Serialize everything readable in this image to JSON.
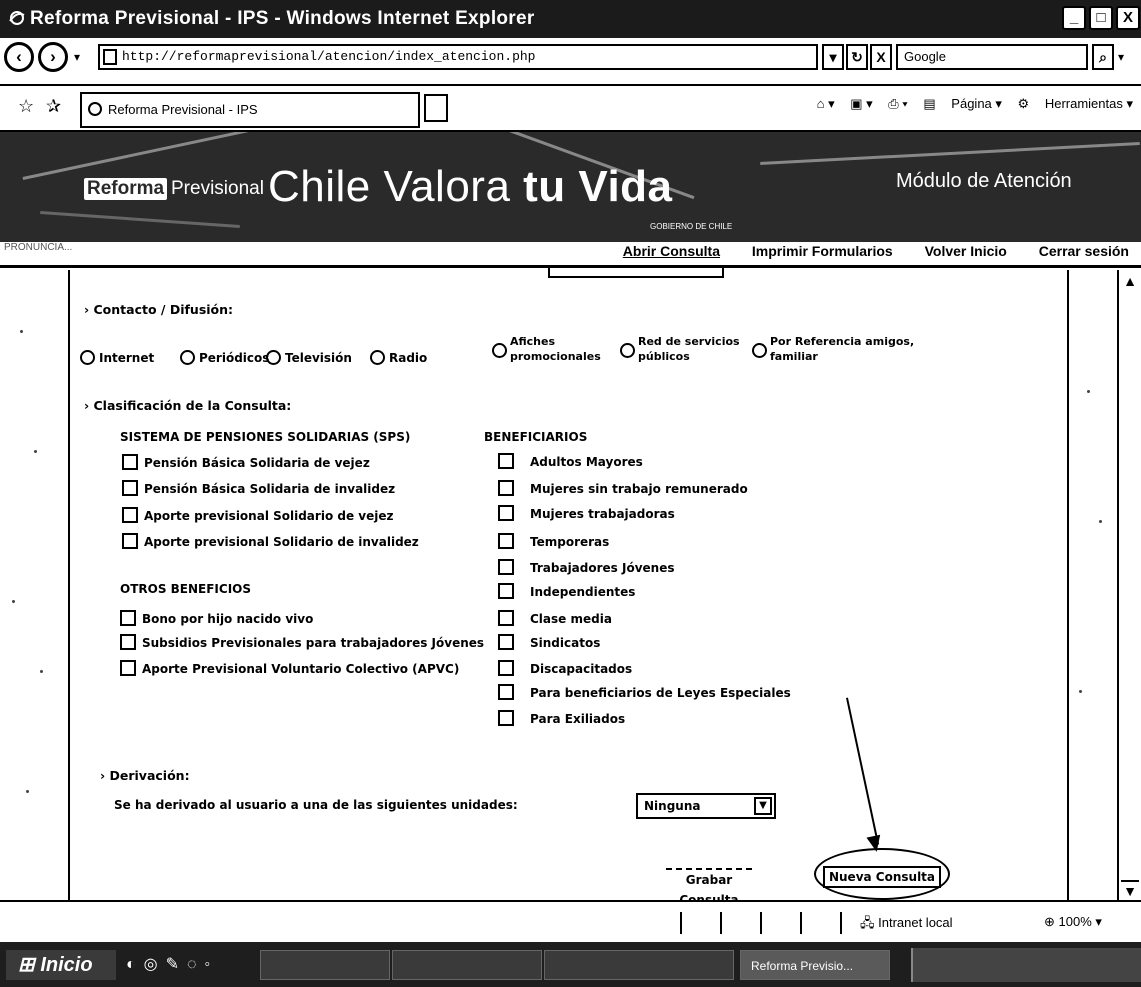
{
  "window": {
    "title": "Reforma Previsional - IPS - Windows Internet Explorer",
    "minimize_glyph": "_",
    "maximize_glyph": "□",
    "close_glyph": "X"
  },
  "address_bar": {
    "url": "http://reformaprevisional/atencion/index_atencion.php",
    "search_value": "Google",
    "refresh_glyph": "↻",
    "stop_glyph": "X"
  },
  "command_bar": {
    "tab_title": "Reforma Previsional - IPS",
    "items": [
      "Página",
      "Herramientas"
    ]
  },
  "banner": {
    "brand_reforma": "Reforma",
    "brand_previsional": "Previsional",
    "slogan_prefix": "Chile Valora ",
    "slogan_bold": "tu Vida",
    "gobierno": "GOBIERNO DE CHILE",
    "module": "Módulo de Atención"
  },
  "page_menu": {
    "crumb": "PRONUNCIA...",
    "items": [
      "Abrir Consulta",
      "Imprimir Formularios",
      "Volver Inicio",
      "Cerrar sesión"
    ]
  },
  "form": {
    "contacto": {
      "heading": "› Contacto / Difusión:",
      "options": [
        "Internet",
        "Periódicos",
        "Televisión",
        "Radio",
        "Afiches promocionales",
        "Red de servicios públicos",
        "Por Referencia amigos, familiar"
      ]
    },
    "clasificacion": {
      "heading": "› Clasificación de la Consulta:",
      "sps_heading": "SISTEMA DE PENSIONES SOLIDARIAS (SPS)",
      "sps_items": [
        "Pensión Básica Solidaria de vejez",
        "Pensión Básica Solidaria de invalidez",
        "Aporte previsional Solidario de vejez",
        "Aporte previsional Solidario de invalidez"
      ],
      "otros_heading": "OTROS BENEFICIOS",
      "otros_items": [
        "Bono por hijo nacido vivo",
        "Subsidios Previsionales para trabajadores Jóvenes",
        "Aporte Previsional Voluntario Colectivo (APVC)"
      ],
      "benef_heading": "BENEFICIARIOS",
      "benef_items": [
        "Adultos Mayores",
        "Mujeres sin trabajo remunerado",
        "Mujeres trabajadoras",
        "Temporeras",
        "Trabajadores Jóvenes",
        "Independientes",
        "Clase media",
        "Sindicatos",
        "Discapacitados",
        "Para beneficiarios de Leyes Especiales",
        "Para Exiliados"
      ]
    },
    "derivacion": {
      "heading": "› Derivación:",
      "label": "Se ha derivado al usuario a una de las siguientes unidades:",
      "select_value": "Ninguna"
    },
    "buttons": {
      "grabar": "Grabar Consulta",
      "nueva": "Nueva Consulta"
    }
  },
  "status_bar": {
    "zone": "Intranet local",
    "zoom": "100%"
  },
  "taskbar": {
    "start": "Inicio",
    "active_task": "Reforma Previsio..."
  }
}
